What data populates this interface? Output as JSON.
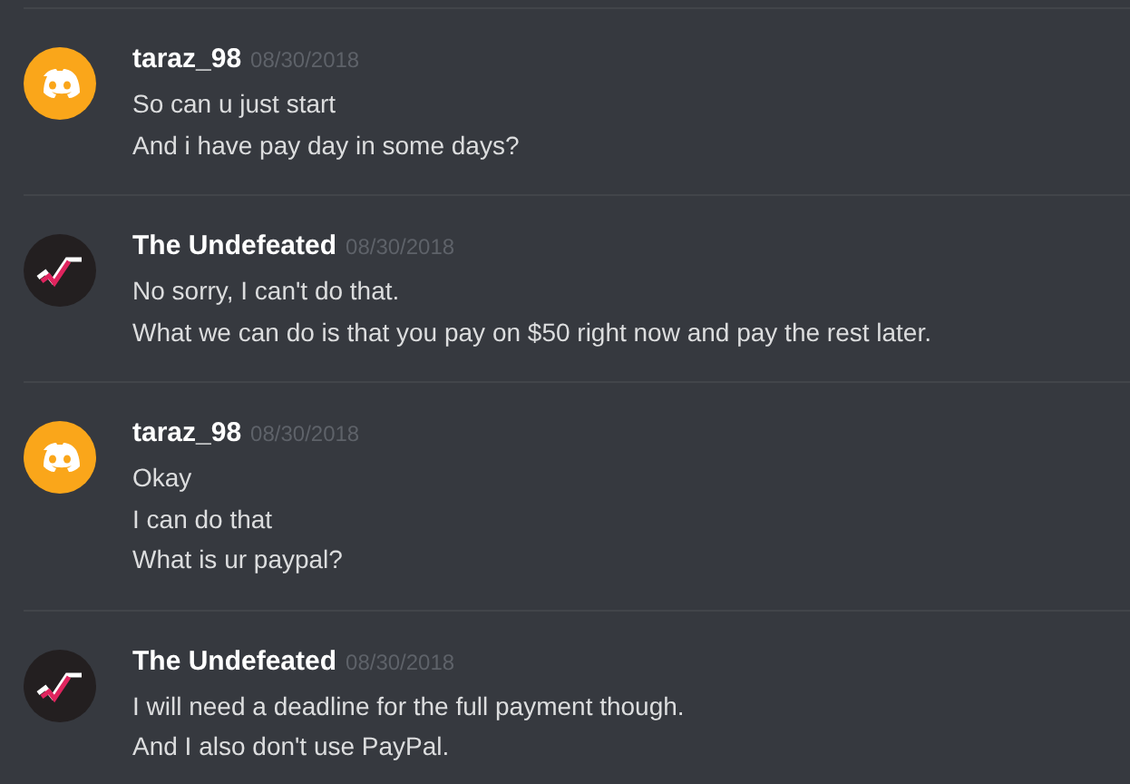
{
  "messages": [
    {
      "avatar": {
        "kind": "discord"
      },
      "author": "taraz_98",
      "timestamp": "08/30/2018",
      "lines": [
        "So can u just start",
        "And i have pay day in some days?"
      ]
    },
    {
      "avatar": {
        "kind": "logo"
      },
      "author": "The Undefeated",
      "timestamp": "08/30/2018",
      "lines": [
        "No sorry, I can't do that.",
        "What we can do is that you pay on $50 right now and pay the rest later."
      ]
    },
    {
      "avatar": {
        "kind": "discord"
      },
      "author": "taraz_98",
      "timestamp": "08/30/2018",
      "lines": [
        "Okay",
        "I can do that",
        "What is ur paypal?"
      ]
    },
    {
      "avatar": {
        "kind": "logo"
      },
      "author": "The Undefeated",
      "timestamp": "08/30/2018",
      "lines": [
        "I will need a deadline for the full payment though.",
        "And I also don't use PayPal."
      ]
    }
  ]
}
